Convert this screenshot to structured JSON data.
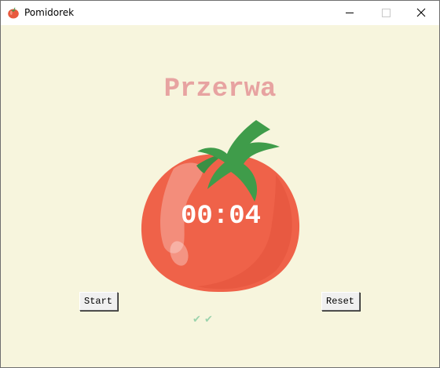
{
  "window": {
    "title": "Pomidorek",
    "app_icon": "tomato-icon",
    "controls": {
      "minimize_icon": "minimize-icon",
      "maximize_icon": "maximize-icon",
      "close_icon": "close-icon"
    }
  },
  "main": {
    "heading": "Przerwa",
    "timer": "00:04",
    "tomato_image": "tomato-illustration",
    "checkmarks": "✔  ✔"
  },
  "buttons": {
    "start_label": "Start",
    "reset_label": "Reset"
  },
  "colors": {
    "background": "#f7f5dd",
    "heading": "#e7a3a1",
    "tomato": "#ef6249",
    "leaves": "#3f9c4a",
    "checkmark": "#9bd3ac",
    "timer_text": "#ffffff"
  }
}
